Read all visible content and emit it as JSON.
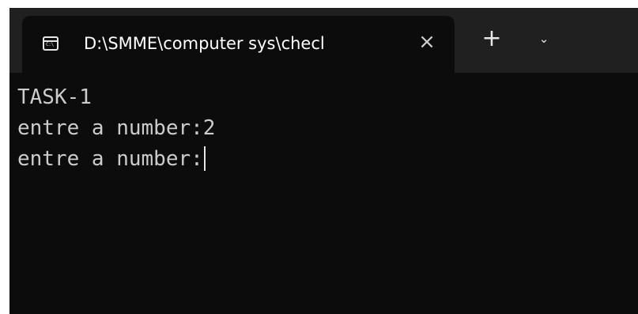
{
  "tab": {
    "title": "D:\\SMME\\computer sys\\checl",
    "icon": "cmd-icon",
    "close_glyph": "×"
  },
  "toolbar": {
    "new_tab_glyph": "+",
    "dropdown_glyph": "⌄"
  },
  "console": {
    "lines": [
      "TASK-1",
      "entre a number:2",
      "entre a number:"
    ]
  },
  "colors": {
    "titlebar": "#202020",
    "terminal_bg": "#0c0c0c",
    "text": "#cccccc"
  }
}
